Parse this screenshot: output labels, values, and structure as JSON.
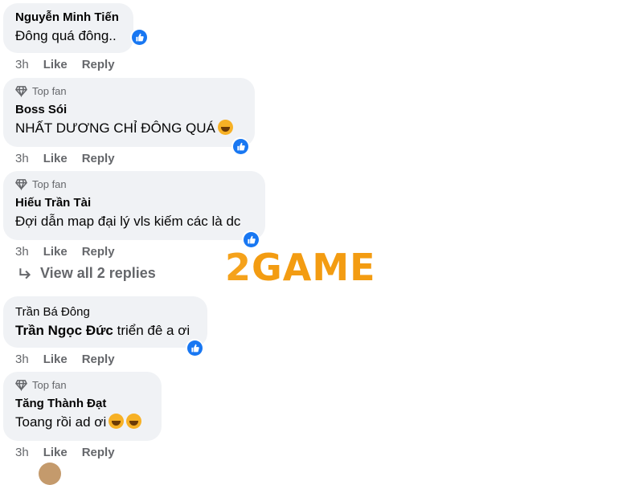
{
  "comments": [
    {
      "author": "Nguyễn Minh Tiến",
      "text": "Đông quá đông..",
      "time": "3h",
      "like": "Like",
      "reply": "Reply"
    },
    {
      "badge": "Top fan",
      "author": "Boss Sói",
      "text": "NHẤT DƯƠNG CHỈ ĐÔNG QUÁ",
      "time": "3h",
      "like": "Like",
      "reply": "Reply"
    },
    {
      "badge": "Top fan",
      "author": "Hiếu Trần Tài",
      "text": "Đợi dẫn map đại lý vls kiếm các là dc",
      "time": "3h",
      "like": "Like",
      "reply": "Reply"
    },
    {
      "author": "Trần Bá Đông",
      "mention": "Trần Ngọc Đức",
      "text": " triển đê a ơi",
      "time": "3h",
      "like": "Like",
      "reply": "Reply"
    },
    {
      "badge": "Top fan",
      "author": "Tăng Thành Đạt",
      "text": "Toang rồi ad ơi",
      "time": "3h",
      "like": "Like",
      "reply": "Reply"
    }
  ],
  "view_replies": "View all 2 replies",
  "watermark": {
    "prefix": "2",
    "text": "GAME"
  },
  "colors": {
    "bubble": "#f0f2f5",
    "meta": "#65676b",
    "like_blue": "#1877f2",
    "watermark": "#f39c12"
  },
  "icons": [
    "diamond-icon",
    "like-thumb-icon",
    "reply-arrow-icon",
    "laughing-emoji-icon",
    "rofl-emoji-icon"
  ]
}
